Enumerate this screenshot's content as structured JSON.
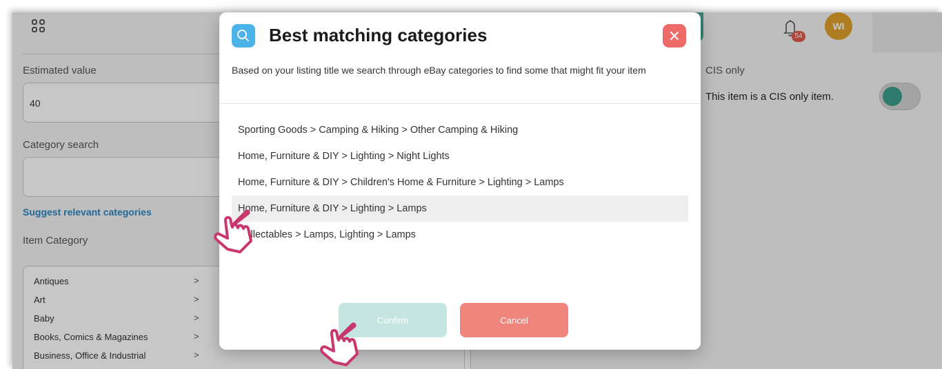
{
  "background": {
    "estimated_value": {
      "label": "Estimated value",
      "value": "40"
    },
    "category_search": {
      "label": "Category search",
      "value": ""
    },
    "suggest_link": "Suggest relevant categories",
    "item_category": {
      "label": "Item Category",
      "items": [
        "Antiques",
        "Art",
        "Baby",
        "Books, Comics & Magazines",
        "Business, Office & Industrial"
      ]
    },
    "notifications": {
      "count": "54"
    },
    "avatar_initials": "WI",
    "cis": {
      "title": "CIS only",
      "text": "This item is a CIS only item."
    }
  },
  "modal": {
    "title": "Best matching categories",
    "description": "Based on your listing title we search through eBay categories to find some that might fit your item",
    "options": [
      "Sporting Goods > Camping & Hiking > Other Camping & Hiking",
      "Home, Furniture & DIY > Lighting > Night Lights",
      "Home, Furniture & DIY > Children's Home & Furniture > Lighting > Lamps",
      "Home, Furniture & DIY > Lighting > Lamps",
      "Collectables > Lamps, Lighting > Lamps"
    ],
    "selected_index": 3,
    "confirm_label": "Confirm",
    "cancel_label": "Cancel"
  },
  "colors": {
    "accent_blue": "#4cb3e8",
    "close_red": "#ee6a66",
    "confirm_teal": "#c5e6e0",
    "cancel_salmon": "#f0857e",
    "cursor_pink": "#c8376e"
  },
  "icons": [
    "grid-icon",
    "search-icon",
    "close-icon",
    "bell-icon",
    "chevron-right-icon",
    "hand-cursor-icon"
  ]
}
